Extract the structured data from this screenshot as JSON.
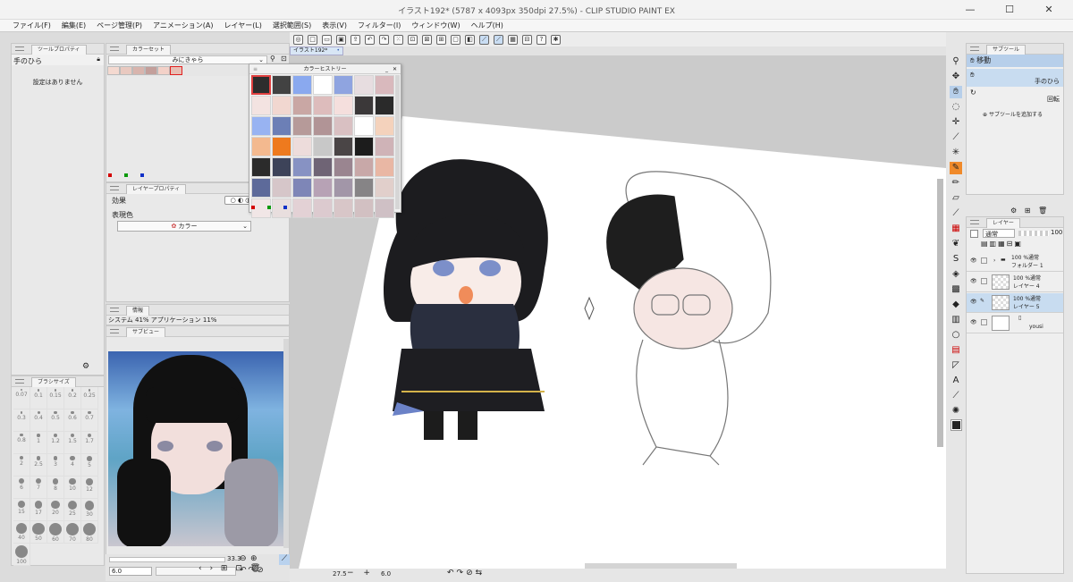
{
  "window": {
    "title": "イラスト192* (5787 x 4093px 350dpi 27.5%) - CLIP STUDIO PAINT EX",
    "minimize": "—",
    "maximize": "☐",
    "close": "✕"
  },
  "menu": [
    "ファイル(F)",
    "編集(E)",
    "ページ管理(P)",
    "アニメーション(A)",
    "レイヤー(L)",
    "選択範囲(S)",
    "表示(V)",
    "フィルター(I)",
    "ウィンドウ(W)",
    "ヘルプ(H)"
  ],
  "tool_property": {
    "tab": "ツールプロパティ",
    "tool_name": "手のひら",
    "empty_message": "設定はありません"
  },
  "color_set": {
    "tab": "カラーセット",
    "set_name": "みにきゃら",
    "colors": [
      "#f4d9d0",
      "#e9c9c0",
      "#d8b4ad",
      "#c39f9b",
      "#f3d1c8",
      "#e8beb4"
    ],
    "indicators": [
      "#d40000",
      "#0a9a0a",
      "#1030c8"
    ]
  },
  "color_history": {
    "title": "カラーヒストリー",
    "colors": [
      "#2d2d2d",
      "#424242",
      "#8aa9ef",
      "#ffffff",
      "#8fa4e0",
      "#e7dde0",
      "#d9b9bd",
      "#f3e3e1",
      "#f1d7d0",
      "#c9a7a4",
      "#ddbcbc",
      "#f5dfdd",
      "#3b3839",
      "#2a2a2a",
      "#98b3f2",
      "#6c7fb6",
      "#b69a99",
      "#b19496",
      "#d9c0c2",
      "#ffffff",
      "#f4d2bc",
      "#f3b98f",
      "#ee7a1e",
      "#eddcdb",
      "#c8c8c8",
      "#4a4546",
      "#1c1c1c",
      "#cfb3b7",
      "#2b2b2b",
      "#3d4359",
      "#8792c3",
      "#6f6475",
      "#9a8590",
      "#c8a8a8",
      "#e9b7a4",
      "#5d6a9a",
      "#d6c6c9",
      "#7e86b7",
      "#b7a2b5",
      "#a296a8",
      "#868486",
      "#e1cfcb",
      "#f1e6e6",
      "#e8dede",
      "#e3d1d5",
      "#dccacf",
      "#d8c6c8",
      "#d2c0c2",
      "#cfc0c5"
    ],
    "indicators": [
      "#d40000",
      "#0a9a0a",
      "#1030c8"
    ]
  },
  "layer_property": {
    "tab": "レイヤープロパティ",
    "effect_label": "効果",
    "expression_color_label": "表現色",
    "expression_color_value": "カラー"
  },
  "info": {
    "tab": "情報",
    "text": "システム 41% アプリケーション 11%"
  },
  "sub_view": {
    "tab": "サブビュー"
  },
  "brush_size": {
    "tab": "ブラシサイズ",
    "sizes": [
      "0.07",
      "0.1",
      "0.15",
      "0.2",
      "0.25",
      "0.3",
      "0.4",
      "0.5",
      "0.6",
      "0.7",
      "0.8",
      "1",
      "1.2",
      "1.5",
      "1.7",
      "2",
      "2.5",
      "3",
      "4",
      "5",
      "6",
      "7",
      "8",
      "10",
      "12",
      "15",
      "17",
      "20",
      "25",
      "30",
      "40",
      "50",
      "60",
      "70",
      "80",
      "100"
    ],
    "bottom_value": "6.0",
    "zoom_value": "33.3"
  },
  "document_tab": "イラスト192*",
  "status": {
    "zoom": "27.5",
    "brush": "6.0"
  },
  "sub_tool": {
    "tab": "サブツール",
    "group": "移動",
    "items": [
      "手のひら",
      "回転"
    ],
    "add_label": "サブツールを追加する"
  },
  "layer_panel": {
    "tab": "レイヤー",
    "blend_mode": "通常",
    "opacity": "100",
    "layers": [
      {
        "top": "100 %通常",
        "name": "フォルダー 1"
      },
      {
        "top": "100 %通常",
        "name": "レイヤー 4"
      },
      {
        "top": "100 %通常",
        "name": "レイヤー 5"
      },
      {
        "top": "",
        "name": "yousi"
      }
    ]
  }
}
